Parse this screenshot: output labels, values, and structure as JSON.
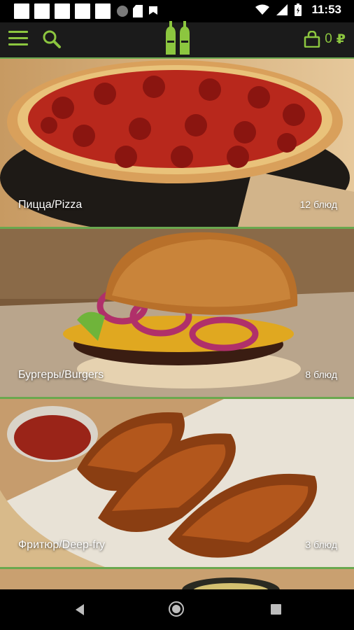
{
  "statusbar": {
    "time": "11:53"
  },
  "header": {
    "menu_icon": "hamburger-menu-icon",
    "search_icon": "search-icon",
    "logo": "salt-pepper-shakers-logo",
    "cart_icon": "shopping-bag-icon",
    "cart_total": "0",
    "currency": "₽"
  },
  "categories": [
    {
      "title": "Пицца/Pizza",
      "count": "12 блюд"
    },
    {
      "title": "Бургеры/Burgers",
      "count": "8 блюд"
    },
    {
      "title": "Фритюр/Deep-fry",
      "count": "3 блюд"
    }
  ],
  "colors": {
    "accent": "#8cc63f",
    "header_bg": "#1b1b1b"
  }
}
